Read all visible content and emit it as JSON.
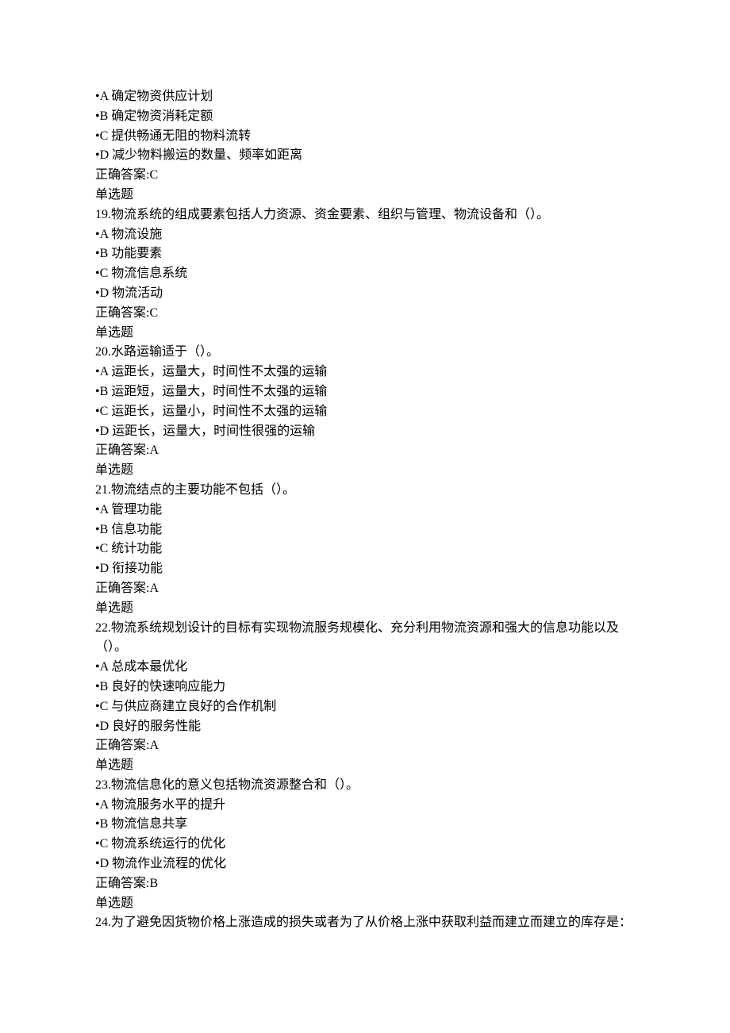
{
  "lines": [
    "•A 确定物资供应计划",
    "•B 确定物资消耗定额",
    "•C 提供畅通无阻的物料流转",
    "•D 减少物料搬运的数量、频率如距离",
    "正确答案:C",
    "单选题",
    "19.物流系统的组成要素包括人力资源、资金要素、组织与管理、物流设备和（）。",
    "•A 物流设施",
    "•B 功能要素",
    "•C 物流信息系统",
    "•D 物流活动",
    "正确答案:C",
    "单选题",
    "20.水路运输适于（）。",
    "•A 运距长，运量大，时间性不太强的运输",
    "•B 运距短，运量大，时间性不太强的运输",
    "•C 运距长，运量小，时间性不太强的运输",
    "•D 运距长，运量大，时间性很强的运输",
    "正确答案:A",
    "单选题",
    "21.物流结点的主要功能不包括（）。",
    "•A 管理功能",
    "•B 信息功能",
    "•C 统计功能",
    "•D 衔接功能",
    "正确答案:A",
    "单选题",
    "22.物流系统规划设计的目标有实现物流服务规模化、充分利用物流资源和强大的信息功能以及（）。",
    "•A 总成本最优化",
    "•B 良好的快速响应能力",
    "•C 与供应商建立良好的合作机制",
    "•D 良好的服务性能",
    "正确答案:A",
    "单选题",
    "23.物流信息化的意义包括物流资源整合和（）。",
    "•A 物流服务水平的提升",
    "•B 物流信息共享",
    "•C 物流系统运行的优化",
    "•D 物流作业流程的优化",
    "正确答案:B",
    "单选题",
    "24.为了避免因货物价格上涨造成的损失或者为了从价格上涨中获取利益而建立而建立的库存是："
  ]
}
